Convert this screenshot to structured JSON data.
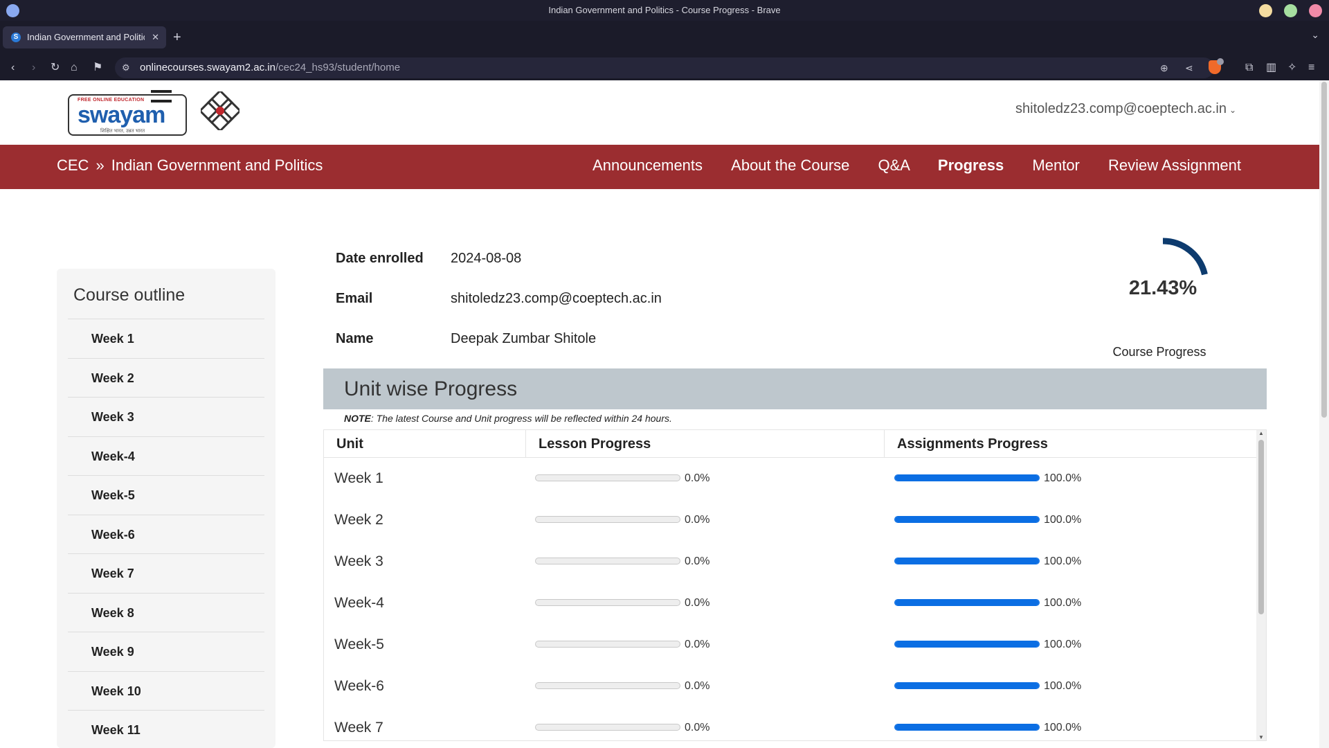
{
  "browser": {
    "window_title": "Indian Government and Politics - Course Progress - Brave",
    "tab_title": "Indian Government and Politics - Course Progress",
    "url_host": "onlinecourses.swayam2.ac.in",
    "url_path": "/cec24_hs93/student/home",
    "new_tab": "+",
    "tab_close": "✕"
  },
  "header": {
    "logo_top": "FREE ONLINE EDUCATION",
    "logo_word": "swayam",
    "logo_tag": "शिक्षित भारत, उन्नत भारत",
    "user_email": "shitoledz23.comp@coeptech.ac.in"
  },
  "course_nav": {
    "crumb_root": "CEC",
    "crumb_sep": "»",
    "crumb_course": "Indian Government and Politics",
    "links": [
      "Announcements",
      "About the Course",
      "Q&A",
      "Progress",
      "Mentor",
      "Review Assignment"
    ],
    "active": "Progress"
  },
  "sidebar": {
    "title": "Course outline",
    "items": [
      "Week 1",
      "Week 2",
      "Week 3",
      "Week-4",
      "Week-5",
      "Week-6",
      "Week 7",
      "Week 8",
      "Week 9",
      "Week 10",
      "Week 11"
    ]
  },
  "profile": {
    "date_label": "Date enrolled",
    "date_value": "2024-08-08",
    "email_label": "Email",
    "email_value": "shitoledz23.comp@coeptech.ac.in",
    "name_label": "Name",
    "name_value": "Deepak Zumbar Shitole"
  },
  "course_progress": {
    "value_text": "21.43%",
    "fraction": 0.2143,
    "caption": "Course Progress",
    "arc_color": "#0d3b6e"
  },
  "unit_progress": {
    "heading": "Unit wise Progress",
    "note_label": "NOTE",
    "note_text": ": The latest Course and Unit progress will be reflected within 24 hours.",
    "columns": [
      "Unit",
      "Lesson Progress",
      "Assignments Progress"
    ],
    "rows": [
      {
        "unit": "Week 1",
        "lesson": 0.0,
        "lesson_text": "0.0%",
        "assign": 1.0,
        "assign_text": "100.0%"
      },
      {
        "unit": "Week 2",
        "lesson": 0.0,
        "lesson_text": "0.0%",
        "assign": 1.0,
        "assign_text": "100.0%"
      },
      {
        "unit": "Week 3",
        "lesson": 0.0,
        "lesson_text": "0.0%",
        "assign": 1.0,
        "assign_text": "100.0%"
      },
      {
        "unit": "Week-4",
        "lesson": 0.0,
        "lesson_text": "0.0%",
        "assign": 1.0,
        "assign_text": "100.0%"
      },
      {
        "unit": "Week-5",
        "lesson": 0.0,
        "lesson_text": "0.0%",
        "assign": 1.0,
        "assign_text": "100.0%"
      },
      {
        "unit": "Week-6",
        "lesson": 0.0,
        "lesson_text": "0.0%",
        "assign": 1.0,
        "assign_text": "100.0%"
      },
      {
        "unit": "Week 7",
        "lesson": 0.0,
        "lesson_text": "0.0%",
        "assign": 1.0,
        "assign_text": "100.0%"
      }
    ],
    "bar_color": "#0b6ee3"
  }
}
